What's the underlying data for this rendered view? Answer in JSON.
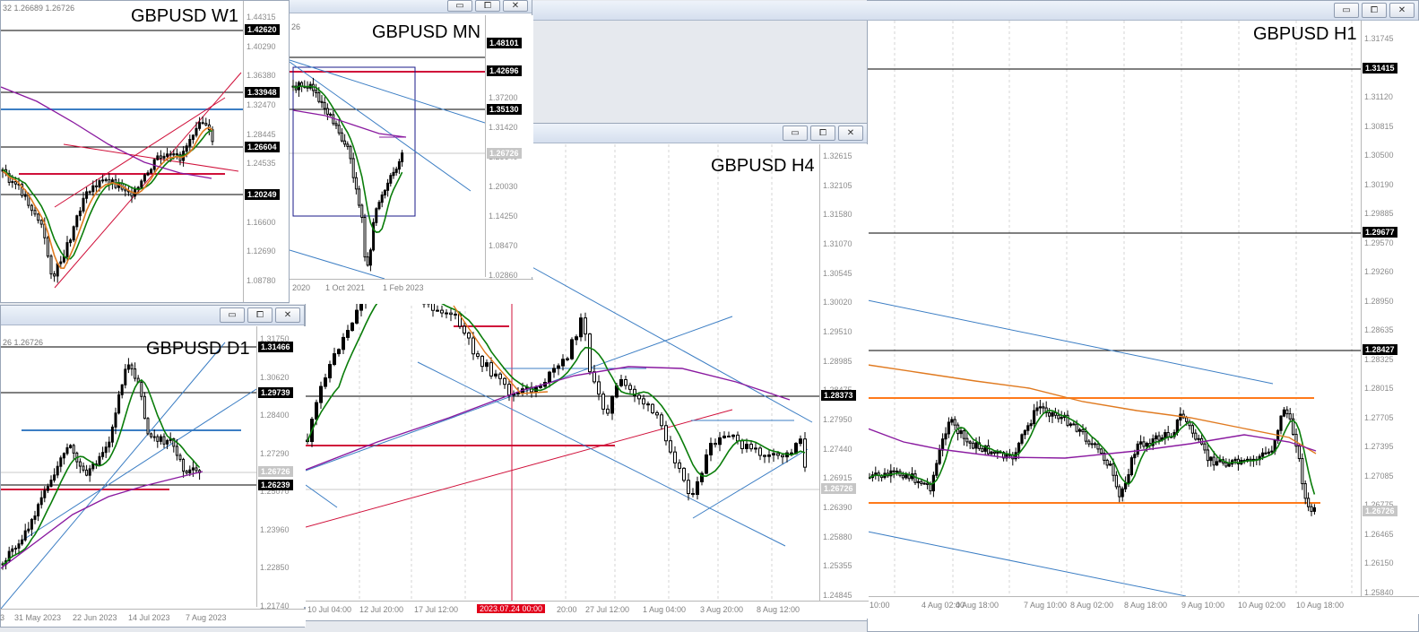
{
  "colors": {
    "bull": "#000000",
    "bear": "#ffffff",
    "ma_fast": "#0a7d0a",
    "ma_mid": "#e07a20",
    "ma_slow": "#8a1aa0",
    "trend": "#3c7ec4",
    "level_red": "#d0103a",
    "level_orange": "#ff7a1a",
    "level_black": "#000000"
  },
  "windows": {
    "h1": {
      "title": "GBPUSD H1",
      "buttons": {
        "minimize": "▭",
        "maximize": "⧠",
        "close": "✕"
      },
      "price_ticks": [
        "1.31745",
        "1.31415",
        "1.31120",
        "1.30815",
        "1.30500",
        "1.30190",
        "1.29885",
        "1.29570",
        "1.29260",
        "1.28950",
        "1.28635",
        "1.28325",
        "1.28015",
        "1.27705",
        "1.27395",
        "1.27085",
        "1.26775",
        "1.26465",
        "1.26150",
        "1.25840"
      ],
      "price_labels": [
        {
          "text": "1.31415",
          "kind": "black"
        },
        {
          "text": "1.29677",
          "kind": "black"
        },
        {
          "text": "1.28427",
          "kind": "black"
        },
        {
          "text": "1.26726",
          "kind": "current"
        }
      ],
      "time_labels": [
        "10:00",
        "4 Aug 02:00",
        "4 Aug 18:00",
        "7 Aug 10:00",
        "8 Aug 02:00",
        "8 Aug 18:00",
        "9 Aug 10:00",
        "10 Aug 02:00",
        "10 Aug 18:00"
      ]
    },
    "h4": {
      "title": "GBPUSD H4",
      "buttons": {
        "minimize": "▭",
        "maximize": "⧠",
        "close": "✕"
      },
      "price_ticks": [
        "1.32615",
        "1.32105",
        "1.31580",
        "1.31070",
        "1.30545",
        "1.30020",
        "1.29510",
        "1.28985",
        "1.28475",
        "1.27950",
        "1.27440",
        "1.26915",
        "1.26390",
        "1.25880",
        "1.25355",
        "1.24845"
      ],
      "price_labels": [
        {
          "text": "1.28373",
          "kind": "black"
        },
        {
          "text": "1.26726",
          "kind": "current"
        }
      ],
      "time_labels": [
        "10 Jul 04:00",
        "12 Jul 20:00",
        "17 Jul 12:00",
        "2023.07.24 00:00",
        "20:00",
        "27 Jul 12:00",
        "1 Aug 04:00",
        "3 Aug 20:00",
        "8 Aug 12:00"
      ]
    },
    "mn": {
      "title": "GBPUSD MN",
      "info": "26",
      "buttons": {
        "minimize": "▭",
        "maximize": "⧠",
        "close": "✕"
      },
      "price_ticks": [
        "1.37200",
        "1.31420",
        "1.25640",
        "1.20030",
        "1.14250",
        "1.08470",
        "1.02860"
      ],
      "price_labels": [
        {
          "text": "1.48101",
          "kind": "black"
        },
        {
          "text": "1.42696",
          "kind": "black"
        },
        {
          "text": "1.35130",
          "kind": "black"
        },
        {
          "text": "1.26726",
          "kind": "current"
        }
      ],
      "time_labels": [
        "2020",
        "1 Oct 2021",
        "1 Feb 2023"
      ]
    },
    "w1": {
      "title": "GBPUSD W1",
      "info": "32 1.26689 1.26726",
      "price_ticks": [
        "1.44315",
        "1.40290",
        "1.36380",
        "1.32470",
        "1.28445",
        "1.24535",
        "1.20510",
        "1.16600",
        "1.12690",
        "1.08780"
      ],
      "price_labels": [
        {
          "text": "1.42620",
          "kind": "black"
        },
        {
          "text": "1.33948",
          "kind": "black"
        },
        {
          "text": "1.26604",
          "kind": "black"
        },
        {
          "text": "1.20249",
          "kind": "black"
        }
      ]
    },
    "d1": {
      "title": "GBPUSD D1",
      "info": "26 1.26726",
      "buttons": {
        "minimize": "▭",
        "maximize": "⧠",
        "close": "✕"
      },
      "price_ticks": [
        "1.31750",
        "1.30620",
        "1.28400",
        "1.27290",
        "1.25070",
        "1.23960",
        "1.22850",
        "1.21740"
      ],
      "price_labels": [
        {
          "text": "1.31466",
          "kind": "black"
        },
        {
          "text": "1.29739",
          "kind": "black"
        },
        {
          "text": "1.26726",
          "kind": "current"
        },
        {
          "text": "1.26239",
          "kind": "black"
        }
      ],
      "time_labels": [
        "3",
        "31 May 2023",
        "22 Jun 2023",
        "14 Jul 2023",
        "7 Aug 2023"
      ]
    }
  }
}
